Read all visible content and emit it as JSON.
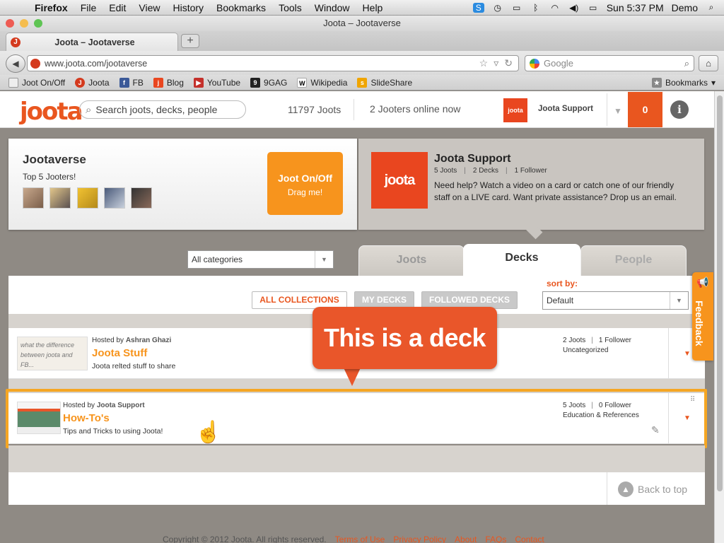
{
  "menubar": {
    "app": "Firefox",
    "items": [
      "File",
      "Edit",
      "View",
      "History",
      "Bookmarks",
      "Tools",
      "Window",
      "Help"
    ],
    "clock": "Sun 5:37 PM",
    "user": "Demo"
  },
  "window": {
    "title": "Joota – Jootaverse"
  },
  "tab": {
    "title": "Joota – Jootaverse",
    "new_tab": "+"
  },
  "navbar": {
    "url": "www.joota.com/jootaverse",
    "search_placeholder": "Google"
  },
  "bookmarks": {
    "items": [
      "Joot On/Off",
      "Joota",
      "FB",
      "Blog",
      "YouTube",
      "9GAG",
      "Wikipedia",
      "SlideShare"
    ],
    "menu": "Bookmarks"
  },
  "header": {
    "logo": "joota",
    "search_placeholder": "Search joots, decks, people",
    "joots_count": "11797 Joots",
    "online": "2 Jooters online now",
    "support_avatar": "joota",
    "support_name": "Joota Support",
    "notifications": "0",
    "info": "i"
  },
  "jootaverse": {
    "title": "Jootaverse",
    "subtitle": "Top 5 Jooters!",
    "joot_button": {
      "line1": "Joot On/Off",
      "line2": "Drag me!"
    }
  },
  "support": {
    "logo": "joota",
    "name": "Joota Support",
    "joots": "5 Joots",
    "decks": "2 Decks",
    "followers": "1 Follower",
    "text": "Need help? Watch a video on a card or catch one of our friendly staff on a LIVE card. Want private assistance? Drop us an email."
  },
  "filters": {
    "category": "All categories",
    "tabs": [
      "Joots",
      "Decks",
      "People"
    ],
    "collections": [
      "ALL COLLECTIONS",
      "MY DECKS",
      "FOLLOWED DECKS"
    ],
    "sort_label": "sort by:",
    "sort_value": "Default"
  },
  "decks": [
    {
      "host_prefix": "Hosted by",
      "host": "Ashran Ghazi",
      "title": "Joota Stuff",
      "desc": "Joota relted stuff to share",
      "joots": "2 Joots",
      "followers": "1 Follower",
      "category": "Uncategorized",
      "thumb_text": "what the difference between joota and FB..."
    },
    {
      "host_prefix": "Hosted by",
      "host": "Joota Support",
      "title": "How-To's",
      "desc": "Tips and Tricks to using Joota!",
      "joots": "5 Joots",
      "followers": "0 Follower",
      "category": "Education & References"
    }
  ],
  "callout": "This is a deck",
  "feedback": "Feedback",
  "back_to_top": "Back to top",
  "footer": {
    "copyright": "Copyright © 2012 Joota. All rights reserved.",
    "links": [
      "Terms of Use",
      "Privacy Policy",
      "About",
      "FAQs",
      "Contact"
    ]
  },
  "colors": {
    "brand": "#e9561f",
    "accent": "#f7941d",
    "highlight": "#f5a623"
  }
}
